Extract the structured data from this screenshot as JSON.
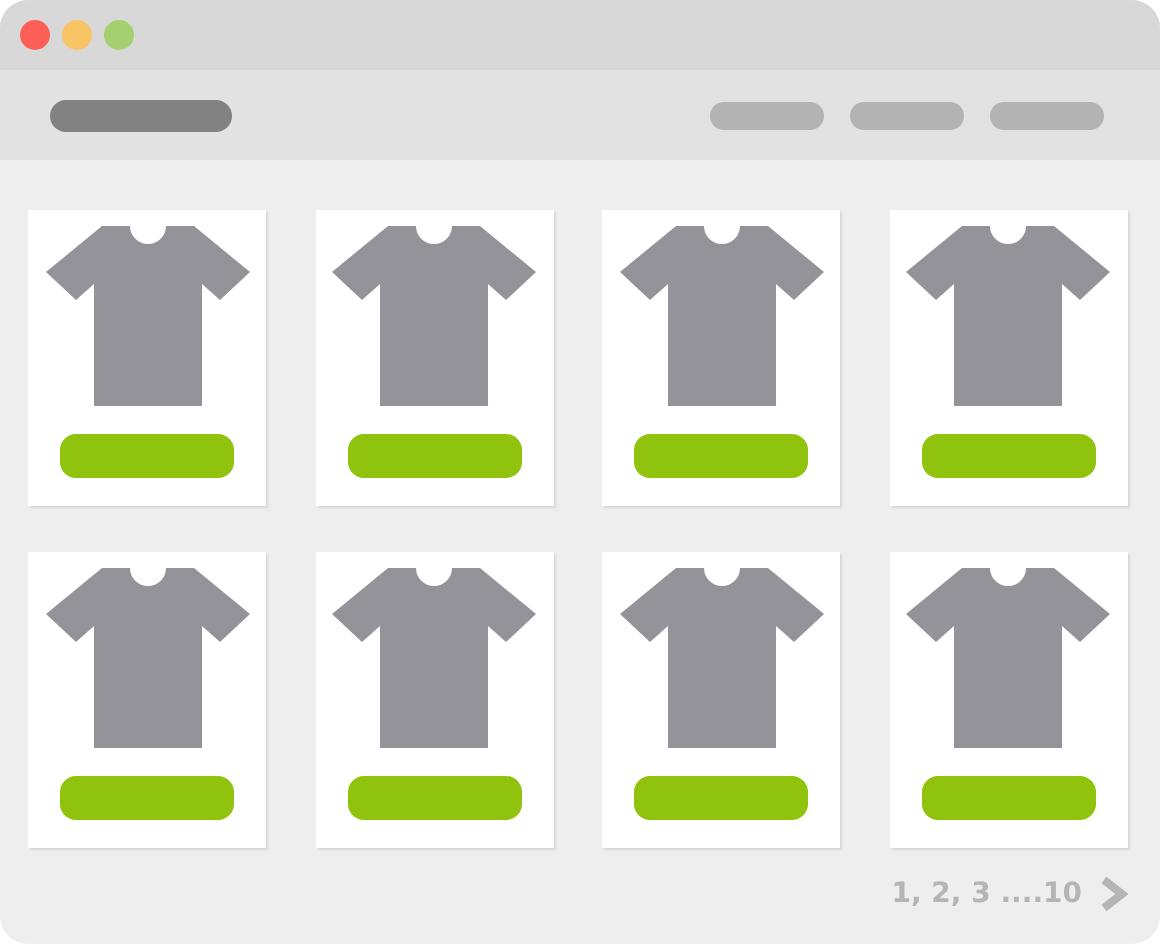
{
  "nav_links": [
    {
      "kind": "placeholder"
    },
    {
      "kind": "placeholder"
    },
    {
      "kind": "placeholder"
    }
  ],
  "products": [
    {
      "kind": "tshirt"
    },
    {
      "kind": "tshirt"
    },
    {
      "kind": "tshirt"
    },
    {
      "kind": "tshirt"
    },
    {
      "kind": "tshirt"
    },
    {
      "kind": "tshirt"
    },
    {
      "kind": "tshirt"
    },
    {
      "kind": "tshirt"
    }
  ],
  "pagination": {
    "pages": "1, 2, 3 ....10"
  }
}
